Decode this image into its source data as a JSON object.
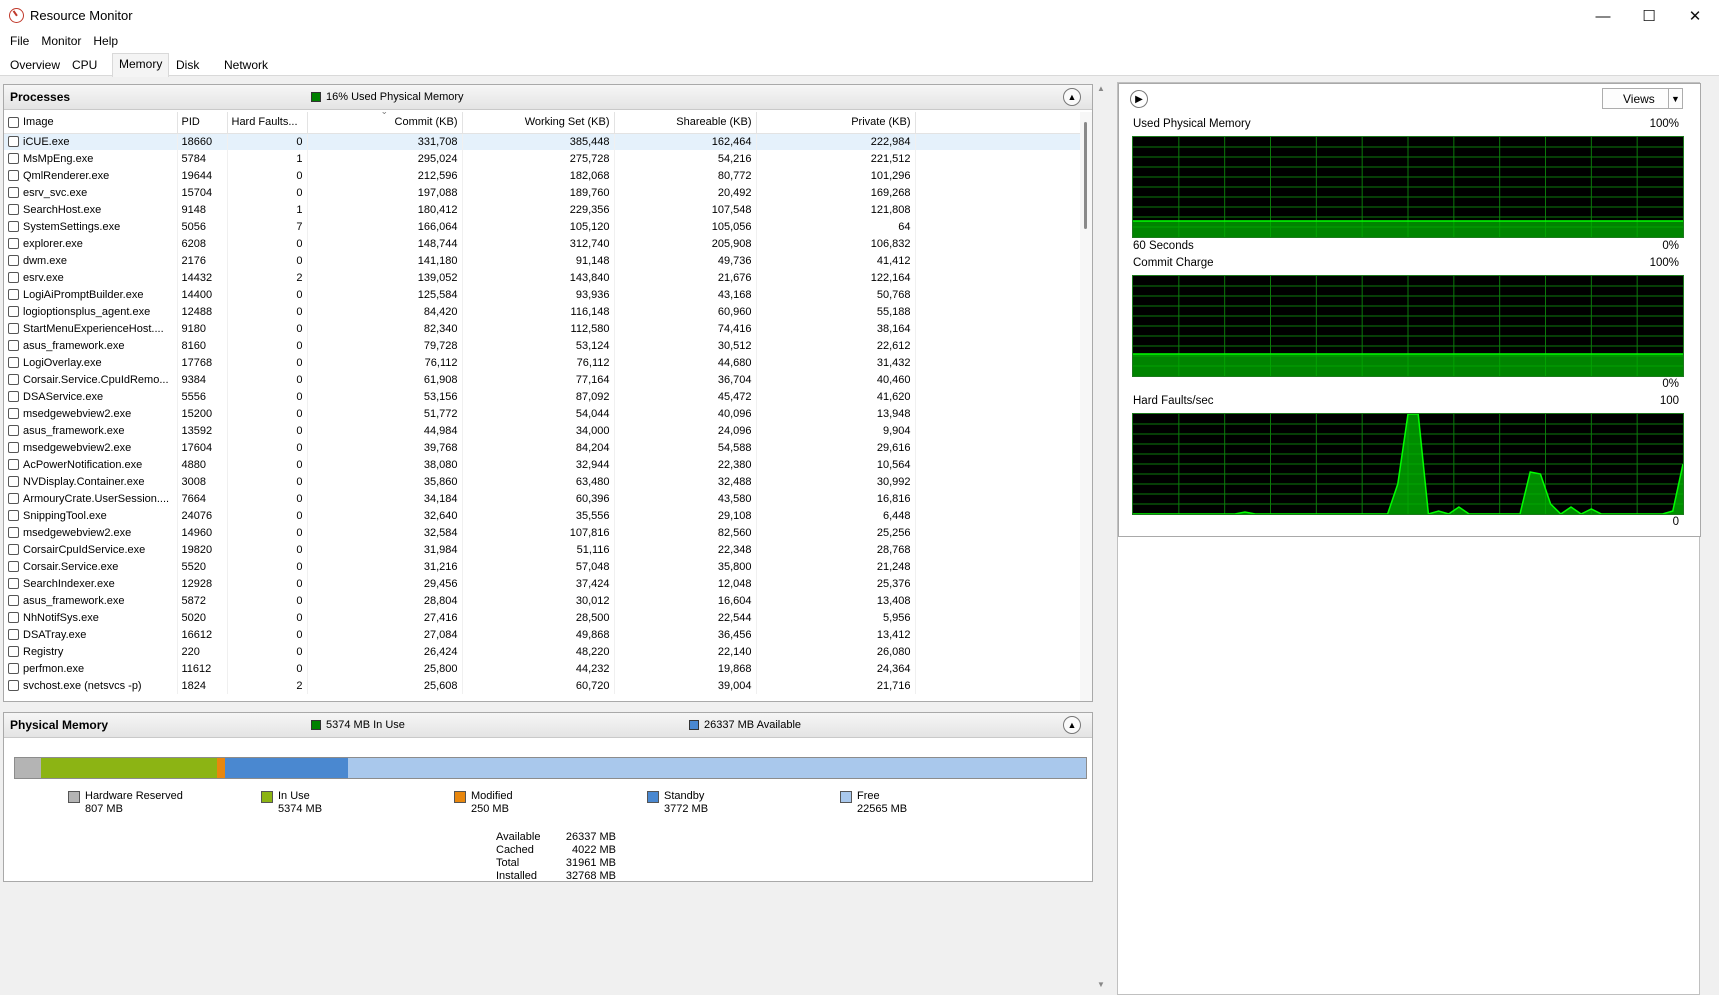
{
  "window": {
    "title": "Resource Monitor",
    "minimize_glyph": "—",
    "maximize_glyph": "☐",
    "close_glyph": "✕"
  },
  "menu": [
    "File",
    "Monitor",
    "Help"
  ],
  "tabs": [
    "Overview",
    "CPU",
    "Memory",
    "Disk",
    "Network"
  ],
  "active_tab": "Memory",
  "processes": {
    "title": "Processes",
    "summary": "16% Used Physical Memory",
    "summary_color": "#008000",
    "columns": [
      "Image",
      "PID",
      "Hard Faults...",
      "Commit (KB)",
      "Working Set (KB)",
      "Shareable (KB)",
      "Private (KB)"
    ],
    "sort_arrow": "⌄",
    "rows": [
      [
        "iCUE.exe",
        "18660",
        "0",
        "331,708",
        "385,448",
        "162,464",
        "222,984"
      ],
      [
        "MsMpEng.exe",
        "5784",
        "1",
        "295,024",
        "275,728",
        "54,216",
        "221,512"
      ],
      [
        "QmlRenderer.exe",
        "19644",
        "0",
        "212,596",
        "182,068",
        "80,772",
        "101,296"
      ],
      [
        "esrv_svc.exe",
        "15704",
        "0",
        "197,088",
        "189,760",
        "20,492",
        "169,268"
      ],
      [
        "SearchHost.exe",
        "9148",
        "1",
        "180,412",
        "229,356",
        "107,548",
        "121,808"
      ],
      [
        "SystemSettings.exe",
        "5056",
        "7",
        "166,064",
        "105,120",
        "105,056",
        "64"
      ],
      [
        "explorer.exe",
        "6208",
        "0",
        "148,744",
        "312,740",
        "205,908",
        "106,832"
      ],
      [
        "dwm.exe",
        "2176",
        "0",
        "141,180",
        "91,148",
        "49,736",
        "41,412"
      ],
      [
        "esrv.exe",
        "14432",
        "2",
        "139,052",
        "143,840",
        "21,676",
        "122,164"
      ],
      [
        "LogiAiPromptBuilder.exe",
        "14400",
        "0",
        "125,584",
        "93,936",
        "43,168",
        "50,768"
      ],
      [
        "logioptionsplus_agent.exe",
        "12488",
        "0",
        "84,420",
        "116,148",
        "60,960",
        "55,188"
      ],
      [
        "StartMenuExperienceHost....",
        "9180",
        "0",
        "82,340",
        "112,580",
        "74,416",
        "38,164"
      ],
      [
        "asus_framework.exe",
        "8160",
        "0",
        "79,728",
        "53,124",
        "30,512",
        "22,612"
      ],
      [
        "LogiOverlay.exe",
        "17768",
        "0",
        "76,112",
        "76,112",
        "44,680",
        "31,432"
      ],
      [
        "Corsair.Service.CpuIdRemo...",
        "9384",
        "0",
        "61,908",
        "77,164",
        "36,704",
        "40,460"
      ],
      [
        "DSAService.exe",
        "5556",
        "0",
        "53,156",
        "87,092",
        "45,472",
        "41,620"
      ],
      [
        "msedgewebview2.exe",
        "15200",
        "0",
        "51,772",
        "54,044",
        "40,096",
        "13,948"
      ],
      [
        "asus_framework.exe",
        "13592",
        "0",
        "44,984",
        "34,000",
        "24,096",
        "9,904"
      ],
      [
        "msedgewebview2.exe",
        "17604",
        "0",
        "39,768",
        "84,204",
        "54,588",
        "29,616"
      ],
      [
        "AcPowerNotification.exe",
        "4880",
        "0",
        "38,080",
        "32,944",
        "22,380",
        "10,564"
      ],
      [
        "NVDisplay.Container.exe",
        "3008",
        "0",
        "35,860",
        "63,480",
        "32,488",
        "30,992"
      ],
      [
        "ArmouryCrate.UserSession....",
        "7664",
        "0",
        "34,184",
        "60,396",
        "43,580",
        "16,816"
      ],
      [
        "SnippingTool.exe",
        "24076",
        "0",
        "32,640",
        "35,556",
        "29,108",
        "6,448"
      ],
      [
        "msedgewebview2.exe",
        "14960",
        "0",
        "32,584",
        "107,816",
        "82,560",
        "25,256"
      ],
      [
        "CorsairCpuIdService.exe",
        "19820",
        "0",
        "31,984",
        "51,116",
        "22,348",
        "28,768"
      ],
      [
        "Corsair.Service.exe",
        "5520",
        "0",
        "31,216",
        "57,048",
        "35,800",
        "21,248"
      ],
      [
        "SearchIndexer.exe",
        "12928",
        "0",
        "29,456",
        "37,424",
        "12,048",
        "25,376"
      ],
      [
        "asus_framework.exe",
        "5872",
        "0",
        "28,804",
        "30,012",
        "16,604",
        "13,408"
      ],
      [
        "NhNotifSys.exe",
        "5020",
        "0",
        "27,416",
        "28,500",
        "22,544",
        "5,956"
      ],
      [
        "DSATray.exe",
        "16612",
        "0",
        "27,084",
        "49,868",
        "36,456",
        "13,412"
      ],
      [
        "Registry",
        "220",
        "0",
        "26,424",
        "48,220",
        "22,140",
        "26,080"
      ],
      [
        "perfmon.exe",
        "11612",
        "0",
        "25,800",
        "44,232",
        "19,868",
        "24,364"
      ],
      [
        "svchost.exe (netsvcs -p)",
        "1824",
        "2",
        "25,608",
        "60,720",
        "39,004",
        "21,716"
      ]
    ]
  },
  "physical_memory": {
    "title": "Physical Memory",
    "in_use_summary": "5374 MB In Use",
    "available_summary": "26337 MB Available",
    "total_mb": 32768,
    "segments": [
      {
        "label": "Hardware Reserved",
        "value": "807 MB",
        "mb": 807,
        "color": "#b4b4b4"
      },
      {
        "label": "In Use",
        "value": "5374 MB",
        "mb": 5374,
        "color": "#8cb414"
      },
      {
        "label": "Modified",
        "value": "250 MB",
        "mb": 250,
        "color": "#e8870e"
      },
      {
        "label": "Standby",
        "value": "3772 MB",
        "mb": 3772,
        "color": "#4a88d0"
      },
      {
        "label": "Free",
        "value": "22565 MB",
        "mb": 22565,
        "color": "#a9c8ec"
      }
    ],
    "summary": [
      {
        "key": "Available",
        "value": "26337 MB"
      },
      {
        "key": "Cached",
        "value": "4022 MB"
      },
      {
        "key": "Total",
        "value": "31961 MB"
      },
      {
        "key": "Installed",
        "value": "32768 MB"
      }
    ]
  },
  "graphs": {
    "views_label": "Views",
    "used_physical_memory": {
      "title": "Used Physical Memory",
      "max": "100%",
      "min": "0%",
      "time": "60 Seconds",
      "level": 0.16
    },
    "commit_charge": {
      "title": "Commit Charge",
      "max": "100%",
      "min": "0%",
      "level": 0.22
    },
    "hard_faults": {
      "title": "Hard Faults/sec",
      "max": "100",
      "min": "0",
      "samples": [
        0,
        0,
        0,
        0,
        0,
        0,
        0,
        0,
        0,
        0,
        0,
        2,
        0,
        0,
        0,
        0,
        0,
        0,
        0,
        0,
        0,
        0,
        0,
        0,
        0,
        0,
        30,
        100,
        100,
        0,
        3,
        0,
        7,
        0,
        0,
        0,
        0,
        0,
        0,
        42,
        40,
        10,
        0,
        7,
        0,
        5,
        0,
        0,
        0,
        0,
        0,
        0,
        0,
        3,
        50
      ]
    },
    "line_color": "#00ff00",
    "fill_color": "#00b000",
    "grid_color": "#0b7a0b"
  }
}
